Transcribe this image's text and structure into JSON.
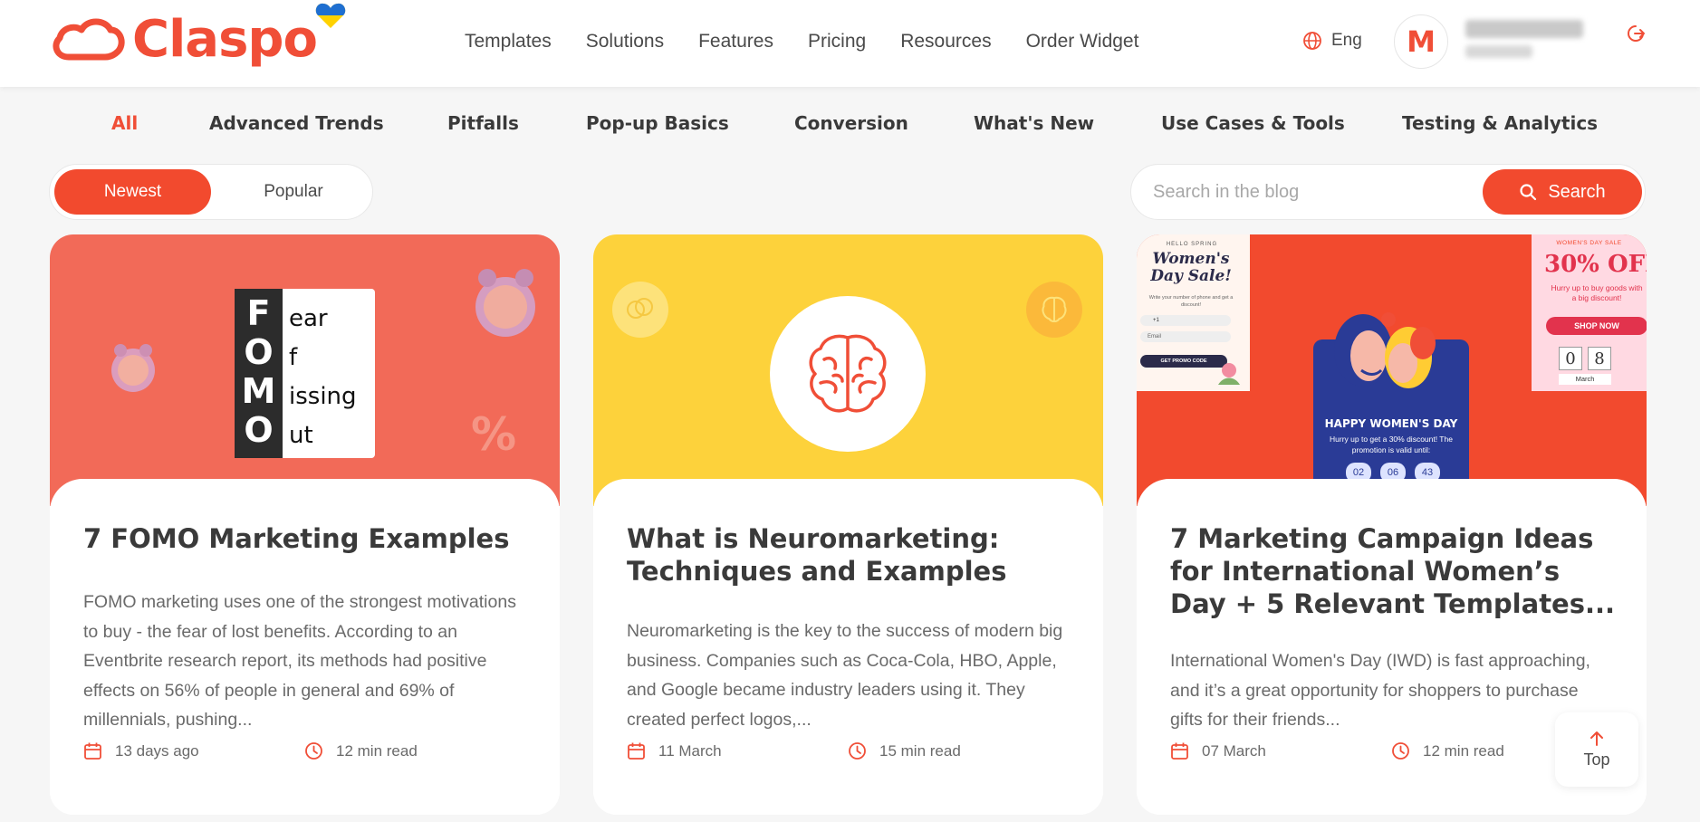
{
  "brand": {
    "name": "Claspo",
    "accent": "#f04e37"
  },
  "nav": [
    "Templates",
    "Solutions",
    "Features",
    "Pricing",
    "Resources",
    "Order Widget"
  ],
  "header": {
    "language": "Eng",
    "avatar_initial": "M"
  },
  "categories": [
    {
      "label": "All",
      "active": true
    },
    {
      "label": "Advanced Trends",
      "active": false
    },
    {
      "label": "Pitfalls",
      "active": false
    },
    {
      "label": "Pop-up Basics",
      "active": false
    },
    {
      "label": "Conversion",
      "active": false
    },
    {
      "label": "What's New",
      "active": false
    },
    {
      "label": "Use Cases & Tools",
      "active": false
    },
    {
      "label": "Testing & Analytics",
      "active": false
    }
  ],
  "sort": {
    "options": [
      "Newest",
      "Popular"
    ],
    "selected": "Newest"
  },
  "search": {
    "placeholder": "Search in the blog",
    "button_label": "Search"
  },
  "cards": [
    {
      "title": "7 FOMO Marketing Examples",
      "excerpt": "FOMO marketing uses one of the strongest motivations to buy - the fear of lost benefits. According to an Eventbrite research report, its methods had positive effects on 56% of people in general and 69% of millennials, pushing...",
      "date": "13 days ago",
      "read_time": "12 min read",
      "image": {
        "bg": "#f26a58",
        "fomo_letters": [
          "F",
          "O",
          "M",
          "O"
        ],
        "fomo_words": [
          "ear",
          "f",
          "issing",
          "ut"
        ],
        "percent": "%"
      }
    },
    {
      "title": "What is Neuromarketing: Techniques and Examples",
      "excerpt": "Neuromarketing is the key to the success of modern big business. Companies such as Coca-Cola, HBO, Apple, and Google became industry leaders using it. They created perfect logos,...",
      "date": "11 March",
      "read_time": "15 min read",
      "image": {
        "bg": "#fdd23b"
      }
    },
    {
      "title": "7 Marketing Campaign Ideas for International Women’s Day + 5 Relevant Templates...",
      "excerpt": "International Women's Day (IWD) is fast approaching, and it’s a great opportunity for shoppers to purchase gifts for their friends...",
      "date": "07 March",
      "read_time": "12 min read",
      "image": {
        "bg": "#f24a2e",
        "left_popup": {
          "kicker": "HELLO SPRING",
          "heading": "Women's Day Sale!",
          "text": "Write your number of phone and get a discount!",
          "phone": "+1",
          "email": "Email",
          "button": "GET PROMO CODE"
        },
        "center_popup": {
          "heading": "HAPPY WOMEN'S DAY",
          "text": "Hurry up to get a 30% discount! The promotion is valid until:",
          "timer": [
            "02",
            "06",
            "43"
          ]
        },
        "right_popup": {
          "kicker": "WOMEN'S DAY SALE",
          "heading": "30% OFF",
          "text": "Hurry up to buy goods with a big discount!",
          "button": "SHOP NOW",
          "calendar_digits": [
            "0",
            "8"
          ],
          "calendar_month": "March"
        }
      }
    }
  ],
  "top_button": "Top"
}
